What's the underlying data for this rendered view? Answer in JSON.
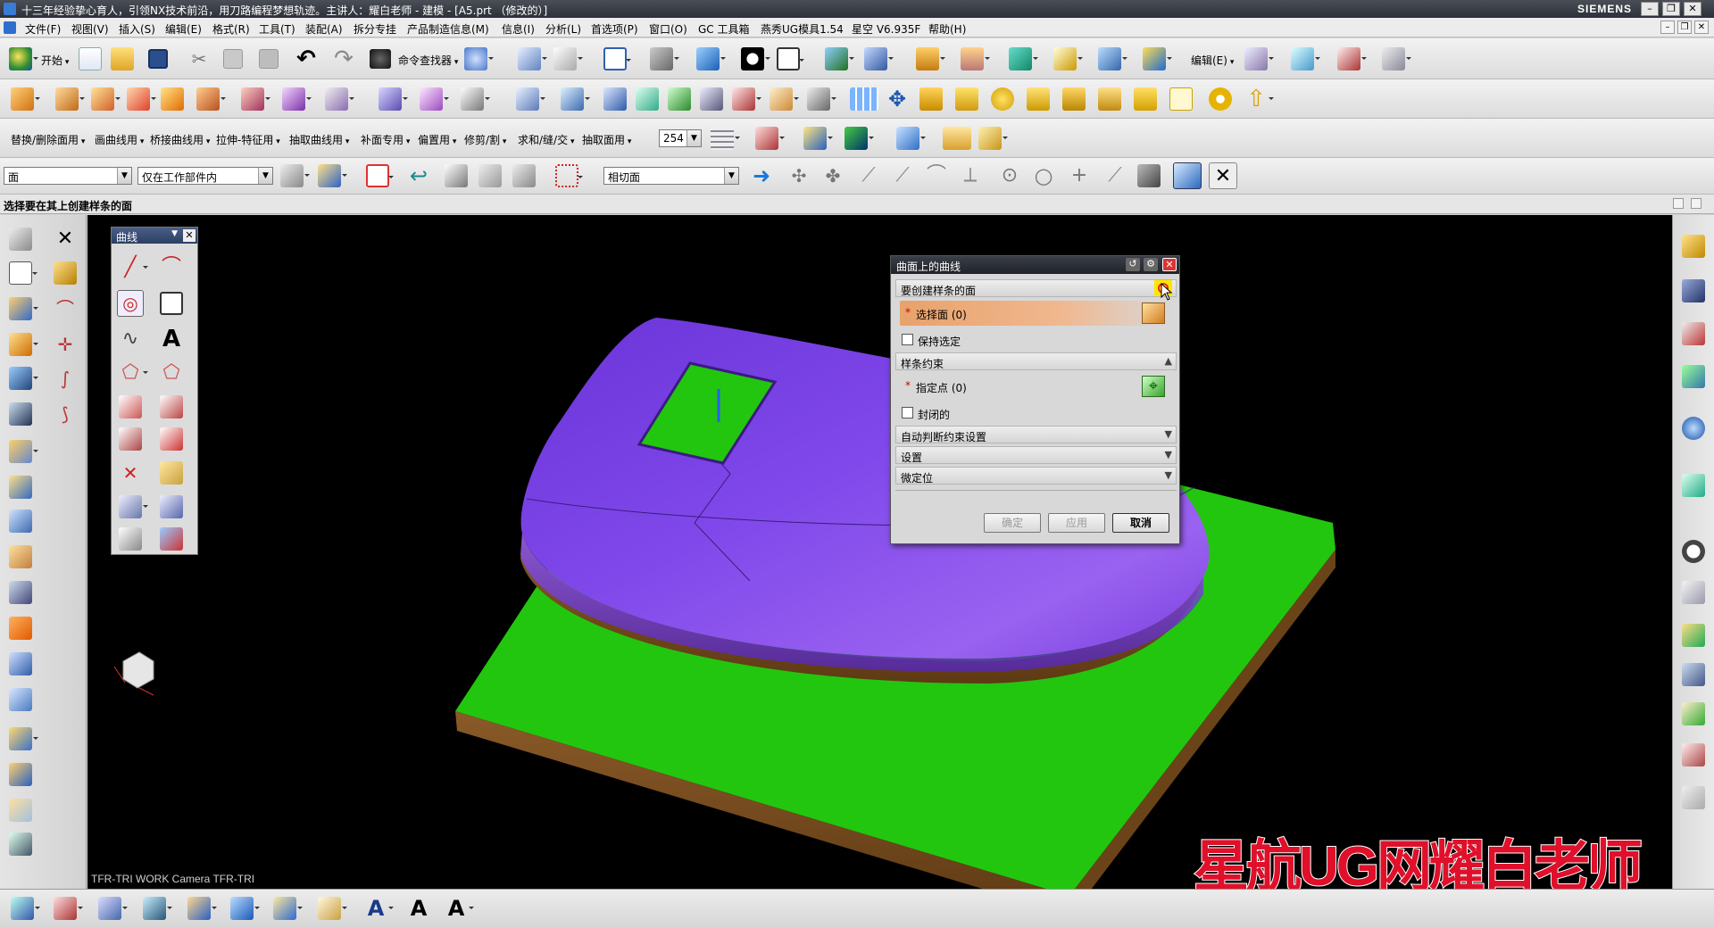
{
  "window": {
    "title": "十三年经验挚心育人，引领NX技术前沿，用刀路编程梦想轨迹。主讲人：耀白老师 - 建模 - [A5.prt （修改的）]",
    "brand": "SIEMENS"
  },
  "menu": [
    "文件(F)",
    "视图(V)",
    "插入(S)",
    "编辑(E)",
    "格式(R)",
    "工具(T)",
    "装配(A)",
    "拆分专挂",
    "产品制造信息(M)",
    "信息(I)",
    "分析(L)",
    "首选项(P)",
    "窗口(O)",
    "GC 工具箱",
    "燕秀UG模具1.54",
    "星空 V6.935F",
    "帮助(H)"
  ],
  "toolbar1": {
    "start_label": "开始",
    "command_finder_label": "命令查找器",
    "edit_label": "编辑(E)"
  },
  "toolbar3": {
    "labels": [
      "替换/删除面用",
      "画曲线用",
      "桥接曲线用",
      "拉伸-特征用",
      "抽取曲线用",
      "补面专用",
      "偏置用",
      "修剪/割",
      "求和/缝/交",
      "抽取面用"
    ],
    "number_value": "254"
  },
  "selection_bar": {
    "filter_value": "面",
    "scope_value": "仅在工作部件内",
    "face_rule_value": "相切面"
  },
  "cue_line": "选择要在其上创建样条的面",
  "palette": {
    "title": "曲线"
  },
  "dialog": {
    "title": "曲面上的曲线",
    "section_faces": "要创建样条的面",
    "select_face": "选择面 (0)",
    "keep_selected": "保持选定",
    "section_spline": "样条约束",
    "specify_point": "指定点 (0)",
    "closed": "封闭的",
    "section_auto": "自动判断约束设置",
    "section_settings": "设置",
    "section_finetune": "微定位",
    "ok": "确定",
    "apply": "应用",
    "cancel": "取消"
  },
  "viewport": {
    "view_label": "TFR-TRI WORK Camera TFR-TRI",
    "watermark": "星航UG网耀白老师"
  },
  "colors": {
    "base_green": "#22c60e",
    "body_purple": "#7a3fe0",
    "base_side": "#7a4a1e",
    "required_highlight": "#e8a26a"
  }
}
